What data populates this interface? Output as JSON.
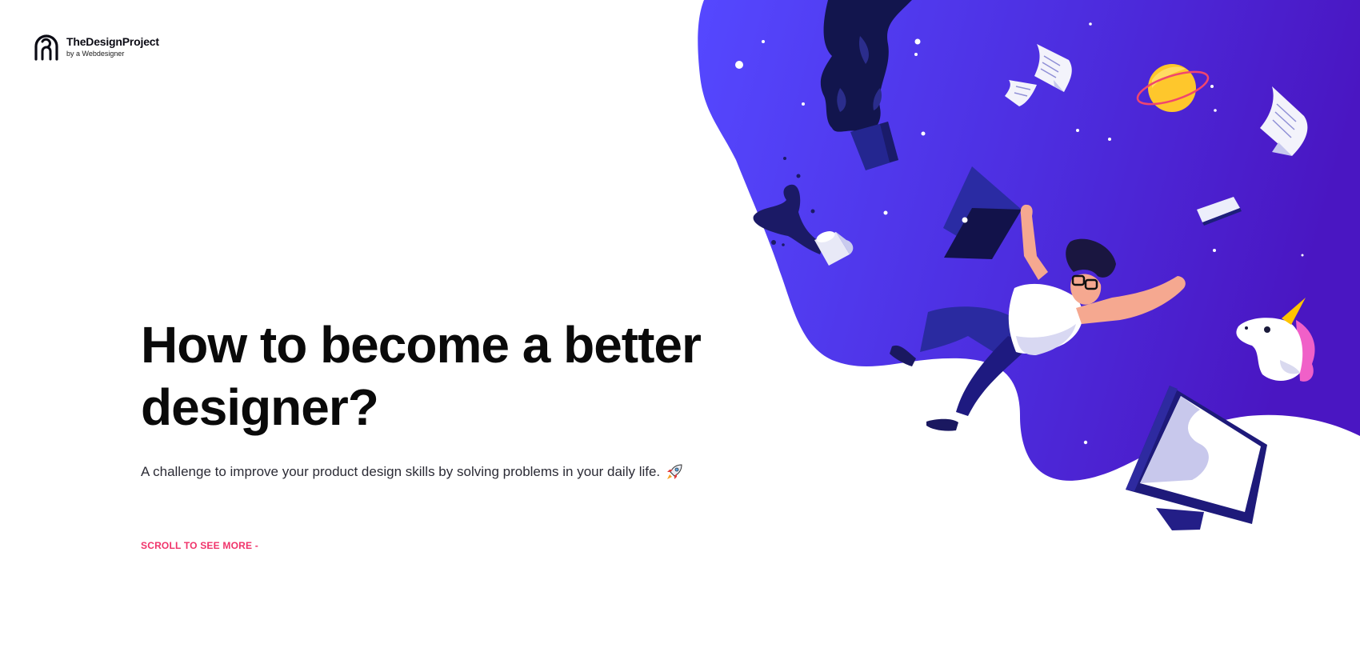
{
  "brand": {
    "name": "TheDesignProject",
    "tagline": "by a Webdesigner"
  },
  "hero": {
    "title_line1": "How to become a better",
    "title_line2": "designer?",
    "subtitle": "A challenge to improve your product design skills by solving problems in your daily life.",
    "subtitle_icon": "rocket-icon"
  },
  "cta": {
    "scroll_label": "SCROLL TO SEE MORE -"
  },
  "colors": {
    "blob_start": "#5145ff",
    "blob_end": "#4a17c4",
    "cta": "#f0336a",
    "navy": "#1e1a7a"
  },
  "illustration": {
    "icons": [
      "plant-icon",
      "coffee-mug-icon",
      "laptop-icon",
      "paper-sheet-icon",
      "planet-icon",
      "phone-icon",
      "unicorn-icon",
      "monitor-icon",
      "falling-designer-icon"
    ]
  }
}
